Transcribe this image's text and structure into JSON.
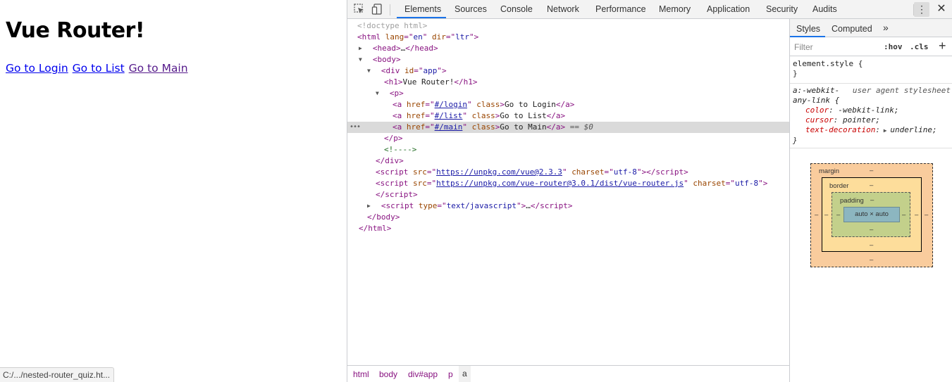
{
  "page": {
    "heading": "Vue Router!",
    "links": [
      "Go to Login",
      "Go to List",
      "Go to Main"
    ],
    "status_url": "C:/.../nested-router_quiz.ht..."
  },
  "devtools": {
    "tabs": [
      "Elements",
      "Sources",
      "Console",
      "Network",
      "Performance",
      "Memory",
      "Application",
      "Security",
      "Audits"
    ],
    "active_tab": "Elements",
    "kebab": "⋮",
    "close": "✕",
    "dom": {
      "doctype": "<!doctype html>",
      "html_open_tag": "html",
      "html_lang_attr": "lang",
      "html_lang_val": "en",
      "html_dir_attr": "dir",
      "html_dir_val": "ltr",
      "head_tag": "head",
      "head_ellipsis": "…",
      "body_tag": "body",
      "div_tag": "div",
      "div_id_attr": "id",
      "div_id_val": "app",
      "h1_tag": "h1",
      "h1_text": "Vue Router!",
      "p_tag": "p",
      "a_tag": "a",
      "href_attr": "href",
      "class_attr": "class",
      "links": [
        {
          "href": "#/login",
          "text": "Go to Login"
        },
        {
          "href": "#/list",
          "text": "Go to List"
        },
        {
          "href": "#/main",
          "text": "Go to Main"
        }
      ],
      "selected_marker": "== $0",
      "comment": "<!---->",
      "script_tag": "script",
      "src_attr": "src",
      "charset_attr": "charset",
      "charset_val": "utf-8",
      "scripts": [
        "https://unpkg.com/vue@2.3.3",
        "https://unpkg.com/vue-router@3.0.1/dist/vue-router.js"
      ],
      "type_attr": "type",
      "type_val": "text/javascript",
      "script_ellipsis": "…"
    },
    "breadcrumbs": [
      "html",
      "body",
      "div#app",
      "p",
      "a"
    ],
    "styles": {
      "tabs": [
        "Styles",
        "Computed",
        "»"
      ],
      "filter_placeholder": "Filter",
      "hov": ":hov",
      "cls": ".cls",
      "plus": "+",
      "element_style_selector": "element.style {",
      "close_brace": "}",
      "ua_selector_line1": "a:-webkit-",
      "ua_selector_line2": "any-link {",
      "ua_source": "user agent stylesheet",
      "properties": [
        {
          "name": "color",
          "value": "-webkit-link;"
        },
        {
          "name": "cursor",
          "value": "pointer;"
        },
        {
          "name": "text-decoration",
          "value": "underline;"
        }
      ],
      "box_model": {
        "margin_label": "margin",
        "border_label": "border",
        "padding_label": "padding",
        "content": "auto × auto",
        "dash": "–"
      }
    },
    "colors": {
      "margin": "#f9cc9d",
      "border": "#fddd9b",
      "padding": "#c3d08b",
      "content": "#8cb6c0",
      "tab_accent": "#1a73e8"
    }
  }
}
